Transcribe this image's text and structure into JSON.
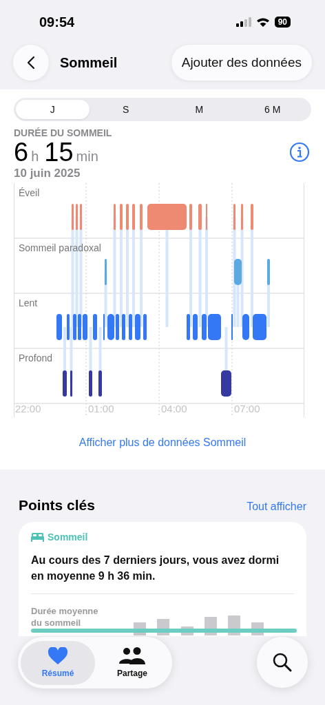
{
  "status_bar": {
    "time": "09:54",
    "battery": "90"
  },
  "nav": {
    "title": "Sommeil",
    "action": "Ajouter des données"
  },
  "periods": [
    {
      "label": "J",
      "selected": true
    },
    {
      "label": "S",
      "selected": false
    },
    {
      "label": "M",
      "selected": false
    },
    {
      "label": "6 M",
      "selected": false
    }
  ],
  "summary": {
    "heading": "DURÉE DU SOMMEIL",
    "hours": "6",
    "hours_unit": "h",
    "minutes": "15",
    "minutes_unit": "min",
    "date": "10 juin 2025"
  },
  "chart": {
    "lanes": [
      "Éveil",
      "Sommeil paradoxal",
      "Lent",
      "Profond"
    ],
    "ticks": [
      "22:00",
      "01:00",
      "04:00",
      "07:00"
    ]
  },
  "more_link": "Afficher plus de données Sommeil",
  "highlights": {
    "title": "Points clés",
    "see_all": "Tout afficher",
    "card": {
      "category": "Sommeil",
      "text": "Au cours des 7 derniers jours, vous avez dormi en moyenne 9 h 36 min.",
      "metric_label": "Durée moyenne du sommeil"
    }
  },
  "tab_bar": [
    {
      "label": "Résumé",
      "kind": "heart",
      "selected": true
    },
    {
      "label": "Partage",
      "kind": "people",
      "selected": false
    }
  ]
}
